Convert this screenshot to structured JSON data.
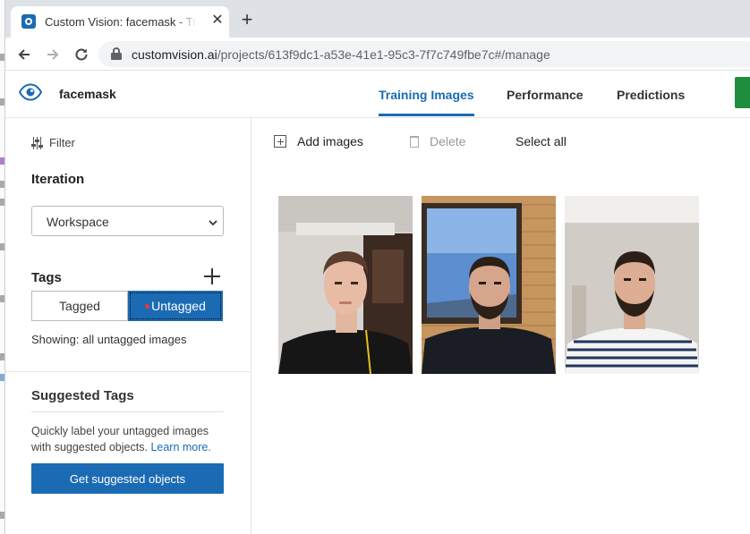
{
  "browser": {
    "tab_title": "Custom Vision: facemask - Training Images",
    "tab_close": "✕",
    "new_tab": "+",
    "url_host": "customvision.ai",
    "url_path": "/projects/613f9dc1-a53e-41e1-95c3-7f7c749fbe7c#/manage"
  },
  "app": {
    "project_name": "facemask",
    "nav_tabs": [
      {
        "label": "Training Images",
        "active": true
      },
      {
        "label": "Performance",
        "active": false
      },
      {
        "label": "Predictions",
        "active": false
      }
    ],
    "accent_color": "#1b6bb4"
  },
  "sidebar": {
    "filter_label": "Filter",
    "iteration_label": "Iteration",
    "iteration_selected": "Workspace",
    "tags_label": "Tags",
    "tag_filters": {
      "tagged": "Tagged",
      "untagged": "Untagged",
      "selected": "untagged"
    },
    "showing_text": "Showing: all untagged images",
    "suggested_tags_label": "Suggested Tags",
    "suggested_desc": "Quickly label your untagged images with suggested objects.",
    "learn_more": "Learn more.",
    "get_suggested_button": "Get suggested objects"
  },
  "main": {
    "actions": {
      "add_images": "Add images",
      "delete": "Delete",
      "select_all": "Select all"
    },
    "images": [
      {
        "subject": "young man indoors, dark shirt"
      },
      {
        "subject": "bearded man by window, brick wall"
      },
      {
        "subject": "bearded man, striped shirt"
      }
    ]
  }
}
